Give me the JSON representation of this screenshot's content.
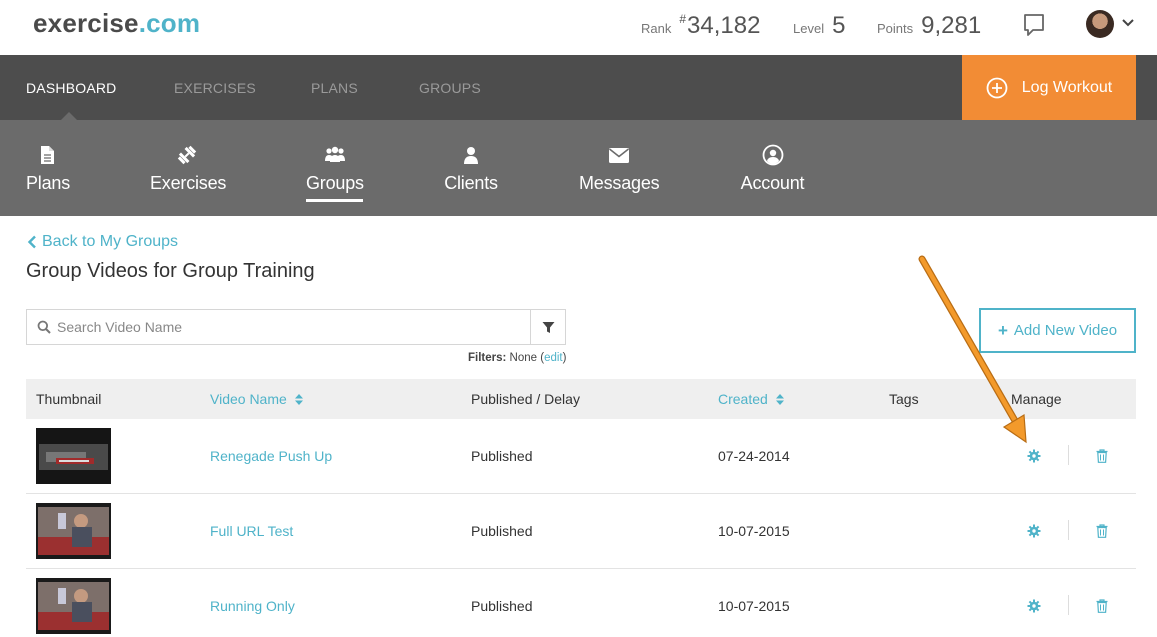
{
  "header": {
    "logo_part1": "exercise",
    "logo_part2": ".com",
    "rank_label": "Rank",
    "rank_hash": "#",
    "rank_value": "34,182",
    "level_label": "Level",
    "level_value": "5",
    "points_label": "Points",
    "points_value": "9,281"
  },
  "mainnav": {
    "items": [
      "DASHBOARD",
      "EXERCISES",
      "PLANS",
      "GROUPS"
    ],
    "log_workout": "Log Workout"
  },
  "subnav": {
    "items": [
      {
        "label": "Plans",
        "icon": "document-icon"
      },
      {
        "label": "Exercises",
        "icon": "dumbbell-icon"
      },
      {
        "label": "Groups",
        "icon": "group-icon"
      },
      {
        "label": "Clients",
        "icon": "user-icon"
      },
      {
        "label": "Messages",
        "icon": "envelope-icon"
      },
      {
        "label": "Account",
        "icon": "account-circle-icon"
      }
    ],
    "active": "Groups"
  },
  "content": {
    "back_label": "Back to My Groups",
    "title": "Group Videos for Group Training",
    "search_placeholder": "Search Video Name",
    "filters_label": "Filters:",
    "filters_value": "None",
    "filters_edit": "edit",
    "add_button": "Add New Video"
  },
  "table": {
    "columns": [
      "Thumbnail",
      "Video Name",
      "Published / Delay",
      "Created",
      "Tags",
      "Manage"
    ],
    "rows": [
      {
        "name": "Renegade Push Up",
        "status": "Published",
        "created": "07-24-2014",
        "tags": ""
      },
      {
        "name": "Full URL Test",
        "status": "Published",
        "created": "10-07-2015",
        "tags": ""
      },
      {
        "name": "Running Only",
        "status": "Published",
        "created": "10-07-2015",
        "tags": ""
      }
    ]
  },
  "colors": {
    "accent": "#4fb3c9",
    "orange": "#f28c35",
    "nav_dark": "#4d4d4d",
    "nav_sub": "#6b6b6b"
  }
}
